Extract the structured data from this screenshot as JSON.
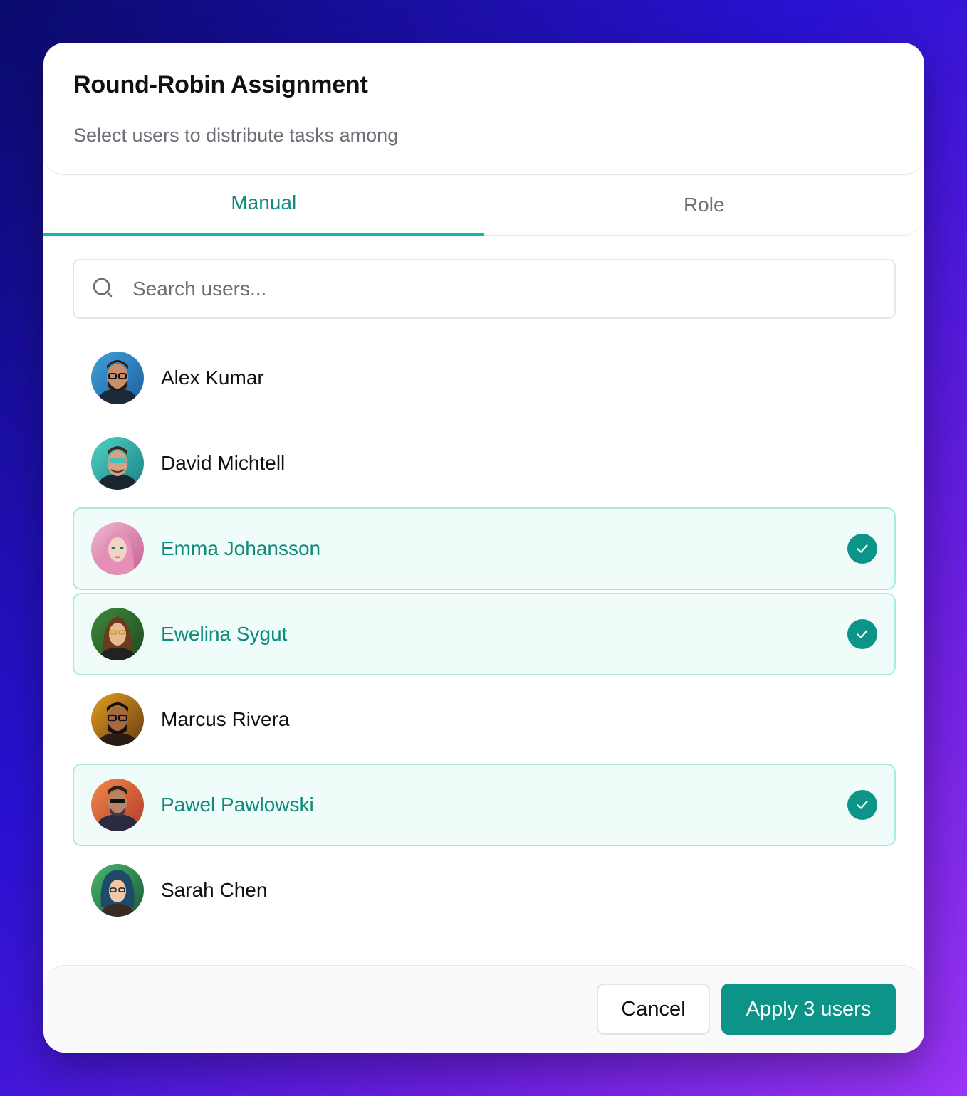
{
  "dialog": {
    "title": "Round-Robin Assignment",
    "subtitle": "Select users to distribute tasks among"
  },
  "tabs": [
    {
      "label": "Manual",
      "active": true
    },
    {
      "label": "Role",
      "active": false
    }
  ],
  "search": {
    "placeholder": "Search users...",
    "value": "",
    "icon": "search-icon"
  },
  "users": [
    {
      "name": "Alex Kumar",
      "selected": false
    },
    {
      "name": "David Michtell",
      "selected": false
    },
    {
      "name": "Emma Johansson",
      "selected": true
    },
    {
      "name": "Ewelina Sygut",
      "selected": true
    },
    {
      "name": "Marcus Rivera",
      "selected": false
    },
    {
      "name": "Pawel Pawlowski",
      "selected": true
    },
    {
      "name": "Sarah Chen",
      "selected": false
    }
  ],
  "footer": {
    "cancel_label": "Cancel",
    "apply_label": "Apply 3 users"
  },
  "colors": {
    "accent": "#0d9488",
    "accent_text": "#0f8a7b",
    "selected_bg": "#effcfa",
    "selected_border": "#a7ecdf"
  }
}
